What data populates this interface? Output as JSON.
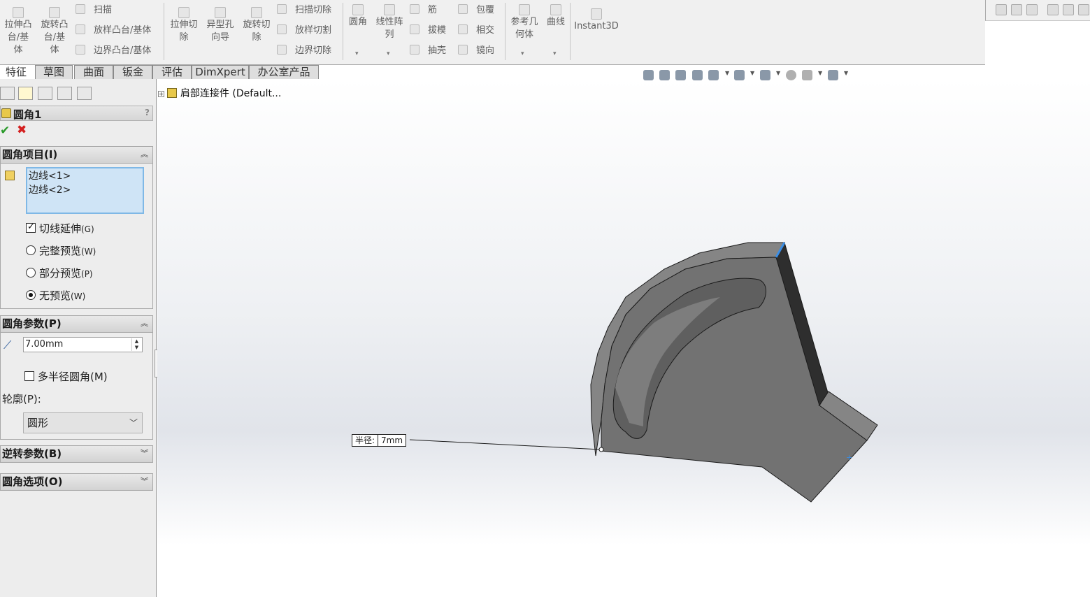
{
  "ribbon": {
    "buttons_large": [
      {
        "label": "拉伸凸\n台/基\n体"
      },
      {
        "label": "旋转凸\n台/基\n体"
      },
      {
        "label": "拉伸切\n除"
      },
      {
        "label": "异型孔\n向导"
      },
      {
        "label": "旋转切\n除"
      },
      {
        "label": "圆角"
      },
      {
        "label": "线性阵\n列"
      },
      {
        "label": "参考几\n何体"
      },
      {
        "label": "曲线"
      },
      {
        "label": "Instant3D"
      }
    ],
    "buttons_small": {
      "sweep": "扫描",
      "loft": "放样凸台/基体",
      "boundary": "边界凸台/基体",
      "sweep_cut": "扫描切除",
      "loft_cut": "放样切割",
      "boundary_cut": "边界切除",
      "rib": "筋",
      "draft": "拔模",
      "shell": "抽壳",
      "wrap": "包覆",
      "intersect": "相交",
      "mirror": "镜向"
    }
  },
  "tabs": [
    "特征",
    "草图",
    "曲面",
    "钣金",
    "评估",
    "DimXpert",
    "办公室产品"
  ],
  "active_tab": "特征",
  "tree": {
    "root": "肩部连接件  (Default..."
  },
  "property_manager": {
    "title": "圆角1",
    "help": "?",
    "fillet_items": {
      "header": "圆角项目(I)",
      "edges": [
        "边线<1>",
        "边线<2>"
      ],
      "tangent_propagation": {
        "label": "切线延伸",
        "key": "(G)",
        "checked": true
      },
      "preview_options": [
        {
          "label": "完整预览",
          "key": "(W)",
          "selected": false
        },
        {
          "label": "部分预览",
          "key": "(P)",
          "selected": false
        },
        {
          "label": "无预览",
          "key": "(W)",
          "selected": true
        }
      ]
    },
    "fillet_params": {
      "header": "圆角参数(P)",
      "radius": "7.00mm",
      "multi_radius": {
        "label": "多半径圆角(M)",
        "checked": false
      },
      "profile_label": "轮廓(P):",
      "profile_value": "圆形"
    },
    "setback_header": "逆转参数(B)",
    "options_header": "圆角选项(O)"
  },
  "viewport": {
    "dim_label": "半径:",
    "dim_value": "7mm",
    "part_color": "#727272",
    "highlight_color": "#3a8ee6"
  }
}
